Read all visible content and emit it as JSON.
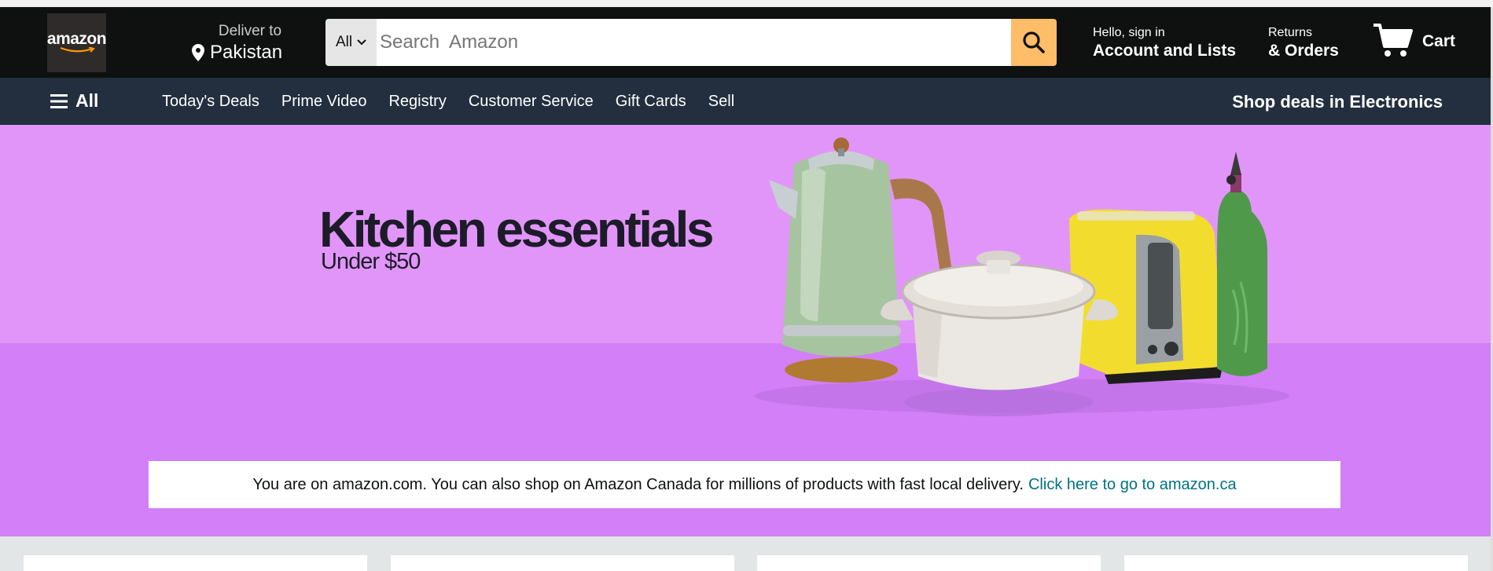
{
  "header": {
    "logo_text": "amazon",
    "deliver_label": "Deliver to",
    "deliver_country": "Pakistan",
    "search": {
      "category": "All",
      "placeholder": "Search  Amazon",
      "value": ""
    },
    "account_small": "Hello, sign in",
    "account_big": "Account and Lists",
    "returns_small": "Returns",
    "returns_big": "& Orders",
    "cart_label": "Cart",
    "icons": [
      "location-pin-icon",
      "chevron-down-icon",
      "search-icon",
      "cart-icon"
    ]
  },
  "nav": {
    "all_label": "All",
    "links": [
      "Today's Deals",
      "Prime Video",
      "Registry",
      "Customer Service",
      "Gift Cards",
      "Sell"
    ],
    "promo": "Shop deals in Electronics",
    "icons": [
      "hamburger-menu-icon"
    ]
  },
  "hero": {
    "title": "Kitchen essentials",
    "subtitle": "Under $50"
  },
  "notice": {
    "text": "You are on amazon.com. You can also shop on Amazon Canada for millions of products with fast local delivery.",
    "link": "Click here to go to amazon.ca"
  },
  "colors": {
    "header_bg": "#0f1111",
    "nav_bg": "#232f3e",
    "search_button": "#febd69",
    "hero_upper": "#e295f9",
    "hero_lower": "#d37ff7",
    "link": "#007185"
  }
}
